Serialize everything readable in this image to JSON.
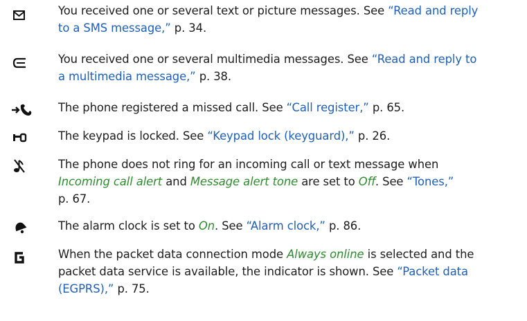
{
  "entries": [
    {
      "icon": "envelope-icon",
      "line1": {
        "prefix": "You received one or several text or picture messages. See ",
        "link": "“Read and reply"
      },
      "line2": {
        "link": "to a SMS message,”",
        "suffix": " p. 34."
      }
    },
    {
      "icon": "multimedia-message-icon",
      "line1": {
        "prefix": "You received one or several multimedia messages. See ",
        "link": "“Read and reply to"
      },
      "line2": {
        "link": "a multimedia message,”",
        "suffix": " p. 38."
      }
    },
    {
      "icon": "missed-call-icon",
      "line1": {
        "prefix": "The phone registered a missed call. See ",
        "link": "“Call register,”",
        "suffix": " p. 65."
      }
    },
    {
      "icon": "key-lock-icon",
      "line1": {
        "prefix": "The keypad is locked. See ",
        "link": "“Keypad lock (keyguard),”",
        "suffix": " p. 26."
      }
    },
    {
      "icon": "silent-mode-icon",
      "line1": {
        "text": "The phone does not ring for an incoming call or text message when"
      },
      "line2": {
        "em1": "Incoming call alert",
        "mid1": " and ",
        "em2": "Message alert tone",
        "mid2": " are set to ",
        "em3": "Off",
        "mid3": ". See ",
        "link": "“Tones,”"
      },
      "line3": {
        "text": "p. 67."
      }
    },
    {
      "icon": "alarm-bell-icon",
      "line1": {
        "prefix": "The alarm clock is set to ",
        "em": "On",
        "mid": ". See ",
        "link": "“Alarm clock,”",
        "suffix": " p. 86."
      }
    },
    {
      "icon": "packet-data-icon",
      "line1": {
        "prefix": "When the packet data connection mode ",
        "em": "Always online",
        "suffix": " is selected and the"
      },
      "line2": {
        "prefix": "packet data service is available, the indicator is shown. See ",
        "link": "“Packet data"
      },
      "line3": {
        "link": "(EGPRS),”",
        "suffix": " p. 75."
      }
    }
  ]
}
